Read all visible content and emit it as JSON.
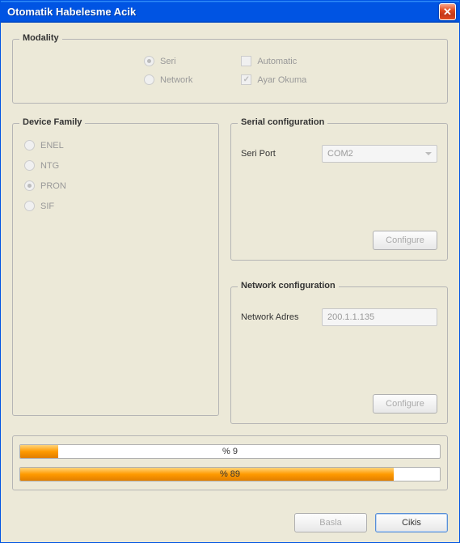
{
  "window": {
    "title": "Otomatik Habelesme Acik"
  },
  "modality": {
    "legend": "Modality",
    "seri_label": "Seri",
    "network_label": "Network",
    "automatic_label": "Automatic",
    "ayar_label": "Ayar Okuma",
    "seri_selected": true,
    "ayar_checked": true
  },
  "device_family": {
    "legend": "Device Family",
    "items": [
      {
        "label": "ENEL",
        "selected": false
      },
      {
        "label": "NTG",
        "selected": false
      },
      {
        "label": "PRON",
        "selected": true
      },
      {
        "label": "SIF",
        "selected": false
      }
    ]
  },
  "serial": {
    "legend": "Serial configuration",
    "port_label": "Seri Port",
    "port_value": "COM2",
    "configure_label": "Configure"
  },
  "network": {
    "legend": "Network configuration",
    "addr_label": "Network Adres",
    "addr_value": "200.1.1.135",
    "configure_label": "Configure"
  },
  "progress": {
    "p1": {
      "percent": 9,
      "label": "% 9"
    },
    "p2": {
      "percent": 89,
      "label": "% 89"
    }
  },
  "footer": {
    "basla_label": "Basla",
    "cikis_label": "Cikis"
  }
}
